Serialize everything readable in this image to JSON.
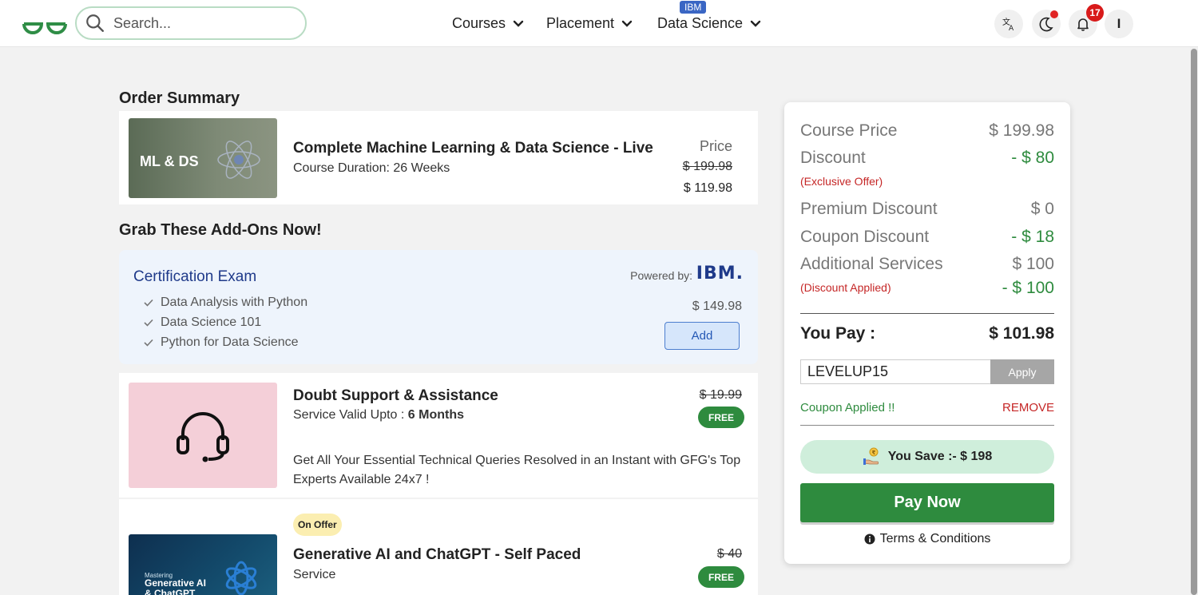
{
  "header": {
    "search_placeholder": "Search...",
    "nav": [
      {
        "label": "Courses"
      },
      {
        "label": "Placement"
      },
      {
        "label": "Data Science",
        "badge": "IBM"
      }
    ],
    "notifications_count": "17",
    "avatar_initial": "I"
  },
  "order_summary": {
    "title": "Order Summary",
    "course": {
      "thumb_label": "ML & DS",
      "title": "Complete Machine Learning & Data Science - Live",
      "duration": "Course Duration: 26 Weeks",
      "price_label": "Price",
      "price_old": "$ 199.98",
      "price_new": "$ 119.98"
    }
  },
  "addons": {
    "title": "Grab These Add-Ons Now!",
    "certification": {
      "title": "Certification Exam",
      "powered_by": "Powered by:",
      "logo_text": "IBM.",
      "items": [
        "Data Analysis with Python",
        "Data Science 101",
        "Python for Data Science"
      ],
      "price": "$ 149.98",
      "add_label": "Add"
    },
    "doubt_support": {
      "title": "Doubt Support & Assistance",
      "sub_prefix": "Service Valid Upto : ",
      "sub_value": "6 Months",
      "desc": "Get All Your Essential Technical Queries Resolved in an Instant with GFG's Top Experts Available 24x7 !",
      "price_old": "$ 19.99",
      "badge": "FREE"
    },
    "gen_ai": {
      "offer_badge": "On Offer",
      "title": "Generative AI and ChatGPT - Self Paced",
      "sub": "Service",
      "price_old": "$ 40",
      "badge": "FREE",
      "thumb_small": "Mastering",
      "thumb_line1": "Generative AI",
      "thumb_line2": "& ChatGPT"
    }
  },
  "summary": {
    "course_price_label": "Course Price",
    "course_price": "$ 199.98",
    "discount_label": "Discount",
    "discount": "- $ 80",
    "discount_note": "(Exclusive Offer)",
    "premium_label": "Premium Discount",
    "premium": "$ 0",
    "coupon_label": "Coupon Discount",
    "coupon": "- $ 18",
    "additional_label": "Additional Services",
    "additional": "$ 100",
    "additional_note": "(Discount Applied)",
    "additional_discount": "- $ 100",
    "you_pay_label": "You Pay :",
    "you_pay": "$ 101.98",
    "coupon_code": "LEVELUP15",
    "apply_label": "Apply",
    "coupon_applied": "Coupon Applied !!",
    "remove_label": "REMOVE",
    "you_save": "You Save :- $ 198",
    "pay_now": "Pay Now",
    "terms": "Terms & Conditions"
  }
}
